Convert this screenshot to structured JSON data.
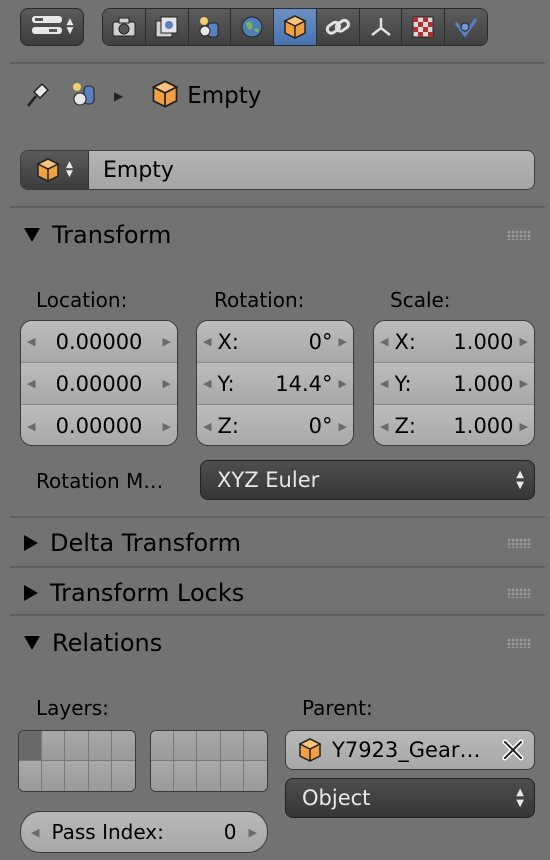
{
  "header": {
    "editor_menu_icon": "view-menu-icon",
    "tabs": [
      {
        "name": "render",
        "icon": "camera-icon",
        "active": false
      },
      {
        "name": "render-layers",
        "icon": "render-layers-icon",
        "active": false
      },
      {
        "name": "scene",
        "icon": "scene-icon",
        "active": false
      },
      {
        "name": "world",
        "icon": "world-icon",
        "active": false
      },
      {
        "name": "object",
        "icon": "cube-icon",
        "active": true
      },
      {
        "name": "constraints",
        "icon": "chain-link-icon",
        "active": false
      },
      {
        "name": "data",
        "icon": "empty-axes-icon",
        "active": false
      },
      {
        "name": "texture",
        "icon": "checker-texture-icon",
        "active": false
      },
      {
        "name": "physics",
        "icon": "physics-icon",
        "active": false
      }
    ],
    "accent_color": "#5680c0"
  },
  "breadcrumb": {
    "pin_icon": "pin-icon",
    "scene_icon": "scene-icon",
    "separator_icon": "chevron-right-icon",
    "object_icon": "cube-icon",
    "label": "Empty"
  },
  "datablock": {
    "name": "Empty"
  },
  "transform": {
    "title": "Transform",
    "location_label": "Location:",
    "rotation_label": "Rotation:",
    "scale_label": "Scale:",
    "location": [
      "0.00000",
      "0.00000",
      "0.00000"
    ],
    "rotation": [
      {
        "axis": "X:",
        "value": "0°"
      },
      {
        "axis": "Y:",
        "value": "14.4°"
      },
      {
        "axis": "Z:",
        "value": "0°"
      }
    ],
    "scale": [
      {
        "axis": "X:",
        "value": "1.000"
      },
      {
        "axis": "Y:",
        "value": "1.000"
      },
      {
        "axis": "Z:",
        "value": "1.000"
      }
    ],
    "rotation_mode_label": "Rotation M…",
    "rotation_mode_value": "XYZ Euler"
  },
  "delta_transform": {
    "title": "Delta Transform"
  },
  "transform_locks": {
    "title": "Transform Locks"
  },
  "relations": {
    "title": "Relations",
    "layers_label": "Layers:",
    "parent_label": "Parent:",
    "parent_value": "Y7923_Gear…",
    "parent_type": "Object",
    "pass_index_label": "Pass Index:",
    "pass_index_value": "0"
  }
}
